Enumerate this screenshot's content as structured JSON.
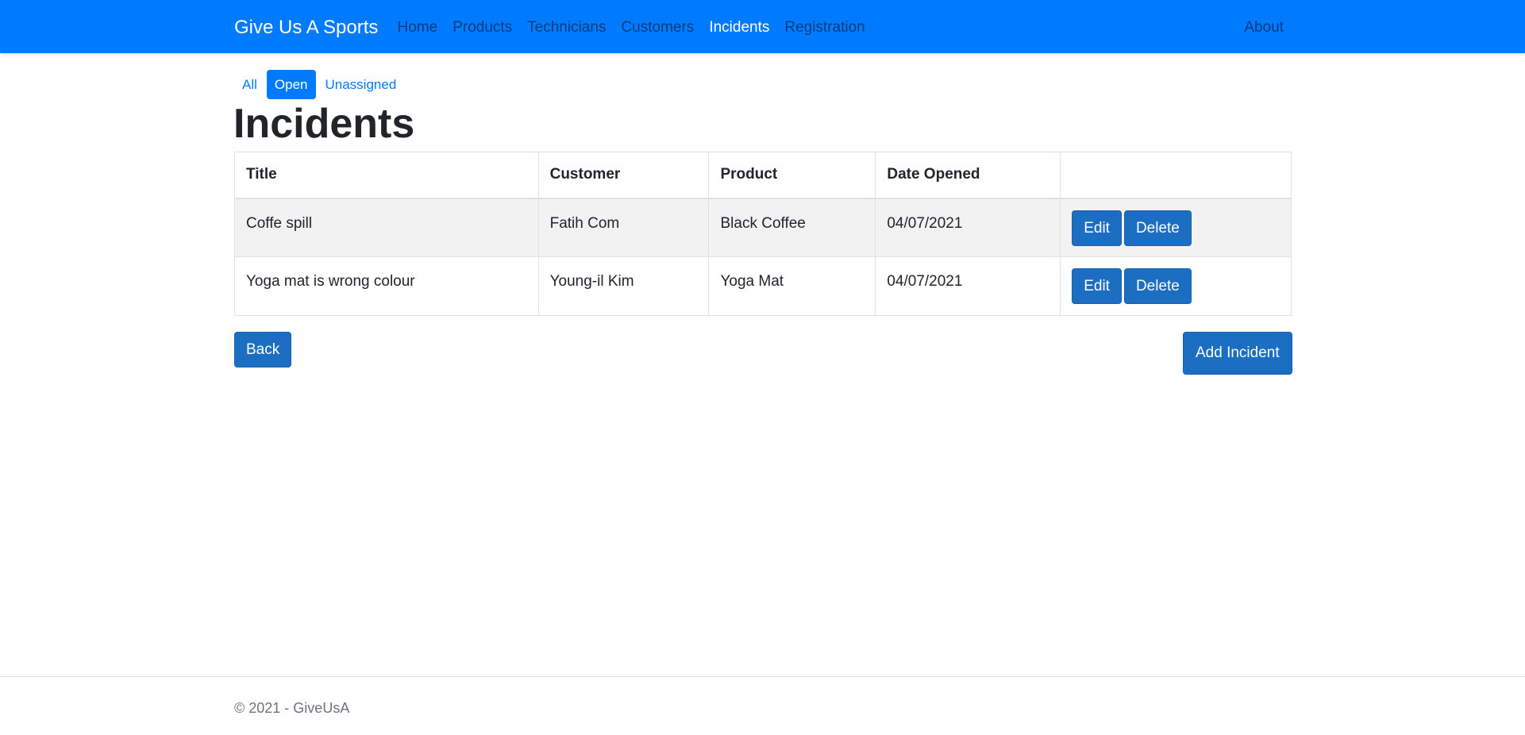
{
  "navbar": {
    "brand": "Give Us A Sports",
    "links": [
      {
        "label": "Home"
      },
      {
        "label": "Products"
      },
      {
        "label": "Technicians"
      },
      {
        "label": "Customers"
      },
      {
        "label": "Incidents"
      },
      {
        "label": "Registration"
      }
    ],
    "active_link": "Incidents",
    "about": "About"
  },
  "filters": {
    "items": [
      {
        "label": "All"
      },
      {
        "label": "Open"
      },
      {
        "label": "Unassigned"
      }
    ],
    "active": "Open"
  },
  "page": {
    "title": "Incidents"
  },
  "table": {
    "headers": [
      "Title",
      "Customer",
      "Product",
      "Date Opened",
      ""
    ],
    "rows": [
      {
        "title": "Coffe spill",
        "customer": "Fatih Com",
        "product": "Black Coffee",
        "date_opened": "04/07/2021",
        "edit_label": "Edit",
        "delete_label": "Delete"
      },
      {
        "title": "Yoga mat is wrong colour",
        "customer": "Young-il Kim",
        "product": "Yoga Mat",
        "date_opened": "04/07/2021",
        "edit_label": "Edit",
        "delete_label": "Delete"
      }
    ]
  },
  "actions": {
    "back_label": "Back",
    "add_label": "Add Incident"
  },
  "footer": {
    "text": "© 2021 - GiveUsA"
  },
  "colors": {
    "navbar_bg": "#007bff",
    "button_bg": "#1b6ec2",
    "link": "#007bff",
    "striped_row": "#f2f2f2"
  }
}
